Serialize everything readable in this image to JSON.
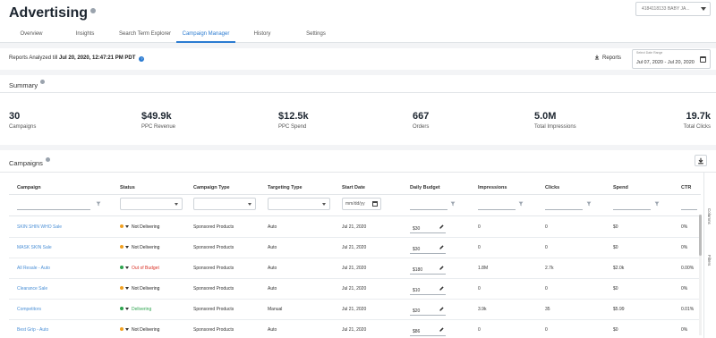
{
  "header": {
    "title": "Advertising",
    "account": "4184118133 BABY JA..."
  },
  "tabs": [
    {
      "label": "Overview"
    },
    {
      "label": "Insights"
    },
    {
      "label": "Search Term Explorer"
    },
    {
      "label": "Campaign Manager"
    },
    {
      "label": "History"
    },
    {
      "label": "Settings"
    }
  ],
  "report": {
    "prefix": "Reports Analyzed till ",
    "timestamp": "Jul 20, 2020, 12:47:21 PM PDT",
    "reports_label": "Reports",
    "date_label": "Select Date Range",
    "date_value": "Jul 07, 2020 - Jul 20, 2020"
  },
  "summary": {
    "title": "Summary",
    "stats": [
      {
        "value": "30",
        "label": "Campaigns"
      },
      {
        "value": "$49.9k",
        "label": "PPC Revenue"
      },
      {
        "value": "$12.5k",
        "label": "PPC Spend"
      },
      {
        "value": "667",
        "label": "Orders"
      },
      {
        "value": "5.0M",
        "label": "Total Impressions"
      },
      {
        "value": "19.7k",
        "label": "Total Clicks"
      }
    ]
  },
  "campaigns": {
    "title": "Campaigns",
    "columns": [
      "Campaign",
      "Status",
      "Campaign Type",
      "Targeting Type",
      "Start Date",
      "Daily Budget",
      "Impressions",
      "Clicks",
      "Spend",
      "CTR"
    ],
    "date_placeholder": "mm/dd/yy",
    "rows": [
      {
        "name": "SKIN SHIN WHO Sale",
        "status": "Not Delivering",
        "status_color": "#f0a020",
        "type": "Sponsored Products",
        "targeting": "Auto",
        "start": "Jul 21, 2020",
        "budget": "$30",
        "impressions": "0",
        "clicks": "0",
        "spend": "$0",
        "ctr": "0%"
      },
      {
        "name": "MASK SKIN Sale",
        "status": "Not Delivering",
        "status_color": "#f0a020",
        "type": "Sponsored Products",
        "targeting": "Auto",
        "start": "Jul 21, 2020",
        "budget": "$30",
        "impressions": "0",
        "clicks": "0",
        "spend": "$0",
        "ctr": "0%"
      },
      {
        "name": "All Resale - Auto",
        "status": "Out of Budget",
        "status_color": "#2ea44f",
        "status_text_color": "#d93025",
        "type": "Sponsored Products",
        "targeting": "Auto",
        "start": "Jul 21, 2020",
        "budget": "$180",
        "impressions": "1.8M",
        "clicks": "2.7k",
        "spend": "$2.0k",
        "ctr": "0.00%"
      },
      {
        "name": "Clearance Sale",
        "status": "Not Delivering",
        "status_color": "#f0a020",
        "type": "Sponsored Products",
        "targeting": "Auto",
        "start": "Jul 21, 2020",
        "budget": "$10",
        "impressions": "0",
        "clicks": "0",
        "spend": "$0",
        "ctr": "0%"
      },
      {
        "name": "Competitors",
        "status": "Delivering",
        "status_color": "#2ea44f",
        "status_text_color": "#2ea44f",
        "type": "Sponsored Products",
        "targeting": "Manual",
        "start": "Jul 21, 2020",
        "budget": "$20",
        "impressions": "3.9k",
        "clicks": "35",
        "spend": "$5.99",
        "ctr": "0.01%"
      },
      {
        "name": "Best Grip - Auto",
        "status": "Not Delivering",
        "status_color": "#f0a020",
        "type": "Sponsored Products",
        "targeting": "Auto",
        "start": "Jul 21, 2020",
        "budget": "$86",
        "impressions": "0",
        "clicks": "0",
        "spend": "$0",
        "ctr": "0%"
      }
    ]
  },
  "side": {
    "columns_label": "Columns",
    "filters_label": "Filters"
  },
  "colors": {
    "accent": "#2b7bd1",
    "link": "#4a8fd6",
    "warning": "#f0a020",
    "success": "#2ea44f",
    "danger": "#d93025"
  }
}
